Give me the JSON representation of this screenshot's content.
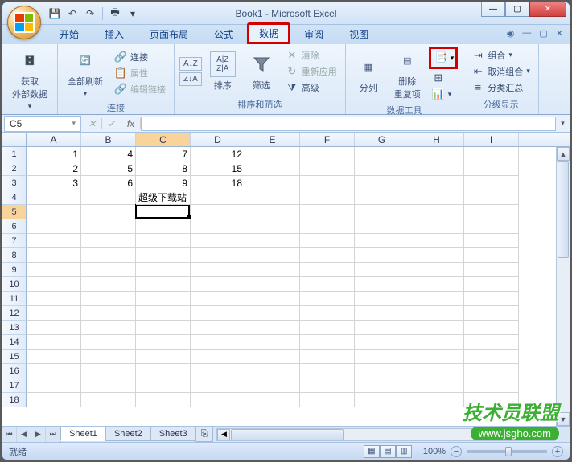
{
  "title": "Book1 - Microsoft Excel",
  "qat": {
    "save": "💾",
    "undo": "↶",
    "redo": "↷",
    "print": "🖶"
  },
  "tabs": {
    "items": [
      "开始",
      "插入",
      "页面布局",
      "公式",
      "数据",
      "审阅",
      "视图"
    ],
    "active_index": 4,
    "highlighted_index": 4
  },
  "doc_controls": {
    "help": "?",
    "min": "—",
    "restore": "▢",
    "close": "✕"
  },
  "ribbon": {
    "group0": {
      "label": "",
      "get_external": "获取\n外部数据"
    },
    "group1": {
      "label": "连接",
      "refresh_all": "全部刷新",
      "connections": "连接",
      "properties": "属性",
      "edit_links": "编辑链接"
    },
    "group2": {
      "label": "排序和筛选",
      "sort_az": "A→Z",
      "sort_za": "Z→A",
      "sort": "排序",
      "filter": "筛选",
      "clear": "清除",
      "reapply": "重新应用",
      "advanced": "高级"
    },
    "group3": {
      "label": "数据工具",
      "text_to_col": "分列",
      "remove_dup": "删除\n重复项"
    },
    "group4": {
      "label": "分级显示",
      "group": "组合",
      "ungroup": "取消组合",
      "subtotal": "分类汇总"
    }
  },
  "name_box": "C5",
  "fx_label": "fx",
  "columns": [
    "A",
    "B",
    "C",
    "D",
    "E",
    "F",
    "G",
    "H",
    "I"
  ],
  "rows": [
    "1",
    "2",
    "3",
    "4",
    "5",
    "6",
    "7",
    "8",
    "9",
    "10",
    "11",
    "12",
    "13",
    "14",
    "15",
    "16",
    "17",
    "18"
  ],
  "selected_row": 5,
  "selected_col": 2,
  "cells": {
    "r0": {
      "A": "1",
      "B": "4",
      "C": "7",
      "D": "12"
    },
    "r1": {
      "A": "2",
      "B": "5",
      "C": "8",
      "D": "15"
    },
    "r2": {
      "A": "3",
      "B": "6",
      "C": "9",
      "D": "18"
    },
    "r3": {
      "C": "超级下载站"
    }
  },
  "sheets": {
    "items": [
      "Sheet1",
      "Sheet2",
      "Sheet3"
    ],
    "active_index": 0
  },
  "status": {
    "ready": "就绪",
    "zoom": "100%",
    "minus": "−",
    "plus": "+"
  },
  "watermark": {
    "line1": "技术员联盟",
    "line2": "www.jsgho.com"
  }
}
